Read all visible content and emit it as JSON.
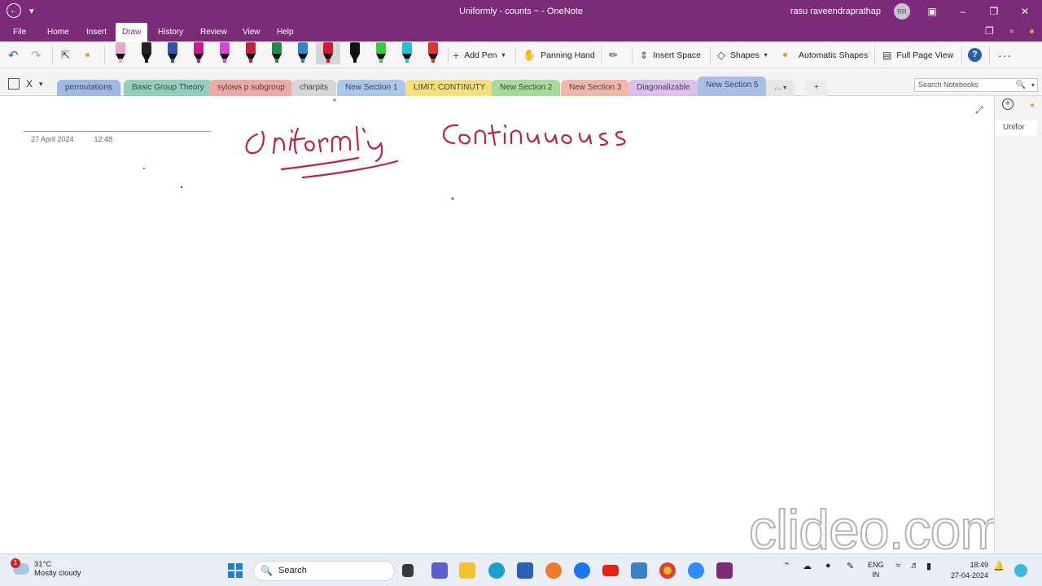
{
  "titlebar": {
    "title": "Uniformly - counts ~  -  OneNote",
    "user": "rasu raveendraprathap",
    "avatar_initials": "RR"
  },
  "menu": {
    "tabs": [
      "File",
      "Home",
      "Insert",
      "Draw",
      "History",
      "Review",
      "View",
      "Help"
    ],
    "active": "Draw"
  },
  "ribbon": {
    "add_pen": "Add Pen",
    "panning_hand": "Panning Hand",
    "insert_space": "Insert Space",
    "shapes": "Shapes",
    "automatic_shapes": "Automatic Shapes",
    "full_page_view": "Full Page View",
    "pens": [
      {
        "cap": "#e9a6c8",
        "nib": "#e9a6c8"
      },
      {
        "cap": "#222222",
        "nib": "#222222"
      },
      {
        "cap": "#2d55a8",
        "nib": "#2d55a8"
      },
      {
        "cap": "#c21f8a",
        "nib": "#c21f8a"
      },
      {
        "cap": "#d848d8",
        "nib": "#d848d8"
      },
      {
        "cap": "#c0243a",
        "nib": "#c0243a"
      },
      {
        "cap": "#1f8a4a",
        "nib": "#1f8a4a"
      },
      {
        "cap": "#2a86c9",
        "nib": "#2a86c9"
      },
      {
        "cap": "#d11a2a",
        "nib": "#d11a2a"
      },
      {
        "cap": "#111111",
        "nib": "#111111"
      },
      {
        "cap": "#2fcf3c",
        "nib": "#2fcf3c"
      },
      {
        "cap": "#20c2d8",
        "nib": "#20c2d8"
      },
      {
        "cap": "#e0302a",
        "nib": "#e0302a"
      }
    ]
  },
  "sections": {
    "tabs": [
      {
        "label": "permutations",
        "color": "#9fb8e6"
      },
      {
        "label": "Basic Group Theory",
        "color": "#8fd0bf"
      },
      {
        "label": "sylows p subgroup",
        "color": "#f1a9a3"
      },
      {
        "label": "charpits",
        "color": "#d6d6d6"
      },
      {
        "label": "New Section 1",
        "color": "#a8c8ee"
      },
      {
        "label": "LIMIT, CONTINUTY",
        "color": "#f3e07c"
      },
      {
        "label": "New Section 2",
        "color": "#a6dc98"
      },
      {
        "label": "New Section 3",
        "color": "#f4b6a6"
      },
      {
        "label": "Diagonalizable",
        "color": "#dcc0ec"
      },
      {
        "label": "New Section 5",
        "color": "#a9bfe8"
      }
    ],
    "more": "...",
    "add": "+",
    "close_label": "X",
    "search_placeholder": "Search Notebooks"
  },
  "page": {
    "date": "27 April 2024",
    "time": "12:48",
    "ink_color": "#c4203a"
  },
  "pages_pane": {
    "add": "+",
    "entry": "Unifor"
  },
  "watermark": "clideo.com",
  "taskbar": {
    "temp": "31°C",
    "weather": "Mostly cloudy",
    "weather_badge": "1",
    "search": "Search",
    "lang": "ENG",
    "region": "IN",
    "time": "18:49",
    "date": "27-04-2024"
  }
}
